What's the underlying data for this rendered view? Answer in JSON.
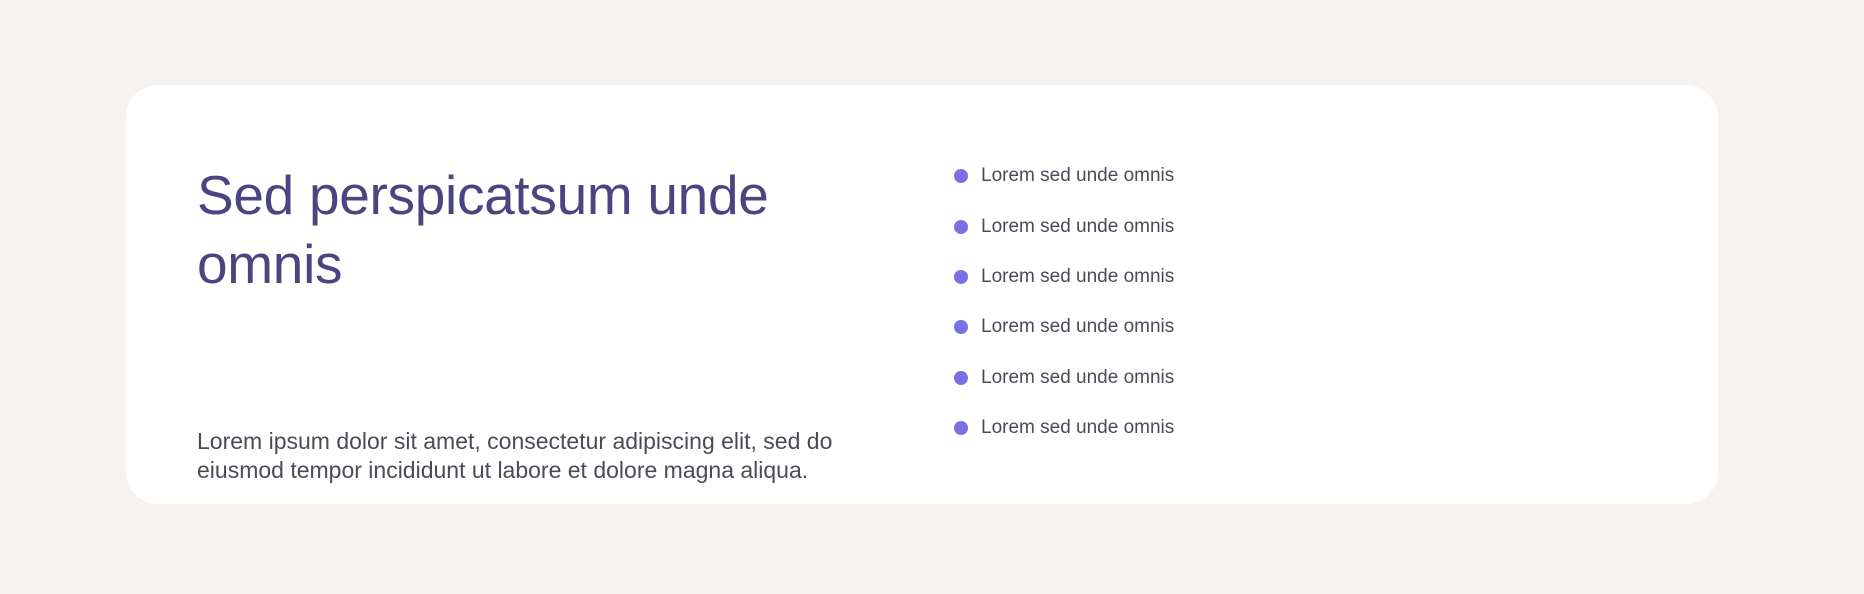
{
  "hero": {
    "title": "Sed perspicatsum unde omnis",
    "description": "Lorem ipsum dolor sit amet, consectetur adipiscing elit, sed do eiusmod tempor incididunt ut labore et dolore magna aliqua."
  },
  "features": {
    "bullet_color": "#7b6fe6",
    "items": [
      "Lorem sed unde omnis",
      "Lorem sed unde omnis",
      "Lorem sed unde omnis",
      "Lorem sed unde omnis",
      "Lorem sed unde omnis",
      "Lorem sed unde omnis"
    ]
  },
  "colors": {
    "background": "#f5f2ef",
    "card": "#ffffff",
    "title": "#4a4580",
    "body_text": "#4b4b58"
  }
}
